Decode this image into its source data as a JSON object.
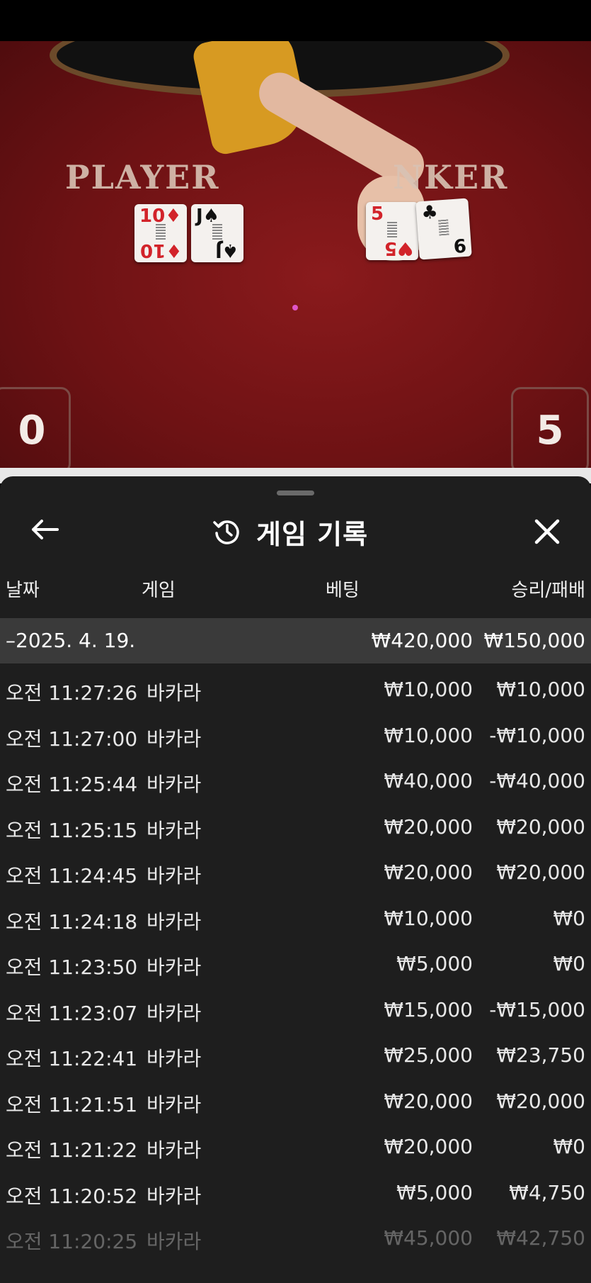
{
  "table": {
    "player_label": "PLAYER",
    "banker_label": "NKER",
    "player_score": "0",
    "banker_score": "5",
    "player_cards": [
      {
        "rank": "10",
        "suit": "♦",
        "color": "red"
      },
      {
        "rank": "J",
        "suit": "♠",
        "color": "black"
      }
    ],
    "banker_cards": [
      {
        "rank": "5",
        "suit": "♥",
        "color": "red"
      },
      {
        "rank": "9",
        "suit": "♣",
        "color": "black"
      }
    ]
  },
  "sheet": {
    "title": "게임 기록",
    "back_icon": "arrow-left-icon",
    "history_icon": "history-icon",
    "close_icon": "close-icon",
    "columns": {
      "date": "날짜",
      "game": "게임",
      "bet": "베팅",
      "result": "승리/패배"
    },
    "date_group": {
      "label": "–2025. 4. 19.",
      "bet_total": "₩420,000",
      "result_total": "₩150,000"
    },
    "rows": [
      {
        "time": "오전 11:27:26",
        "game": "바카라",
        "bet": "₩10,000",
        "result": "₩10,000"
      },
      {
        "time": "오전 11:27:00",
        "game": "바카라",
        "bet": "₩10,000",
        "result": "-₩10,000"
      },
      {
        "time": "오전 11:25:44",
        "game": "바카라",
        "bet": "₩40,000",
        "result": "-₩40,000"
      },
      {
        "time": "오전 11:25:15",
        "game": "바카라",
        "bet": "₩20,000",
        "result": "₩20,000"
      },
      {
        "time": "오전 11:24:45",
        "game": "바카라",
        "bet": "₩20,000",
        "result": "₩20,000"
      },
      {
        "time": "오전 11:24:18",
        "game": "바카라",
        "bet": "₩10,000",
        "result": "₩0"
      },
      {
        "time": "오전 11:23:50",
        "game": "바카라",
        "bet": "₩5,000",
        "result": "₩0"
      },
      {
        "time": "오전 11:23:07",
        "game": "바카라",
        "bet": "₩15,000",
        "result": "-₩15,000"
      },
      {
        "time": "오전 11:22:41",
        "game": "바카라",
        "bet": "₩25,000",
        "result": "₩23,750"
      },
      {
        "time": "오전 11:21:51",
        "game": "바카라",
        "bet": "₩20,000",
        "result": "₩20,000"
      },
      {
        "time": "오전 11:21:22",
        "game": "바카라",
        "bet": "₩20,000",
        "result": "₩0"
      },
      {
        "time": "오전 11:20:52",
        "game": "바카라",
        "bet": "₩5,000",
        "result": "₩4,750"
      },
      {
        "time": "오전 11:20:25",
        "game": "바카라",
        "bet": "₩45,000",
        "result": "₩42,750"
      }
    ]
  }
}
